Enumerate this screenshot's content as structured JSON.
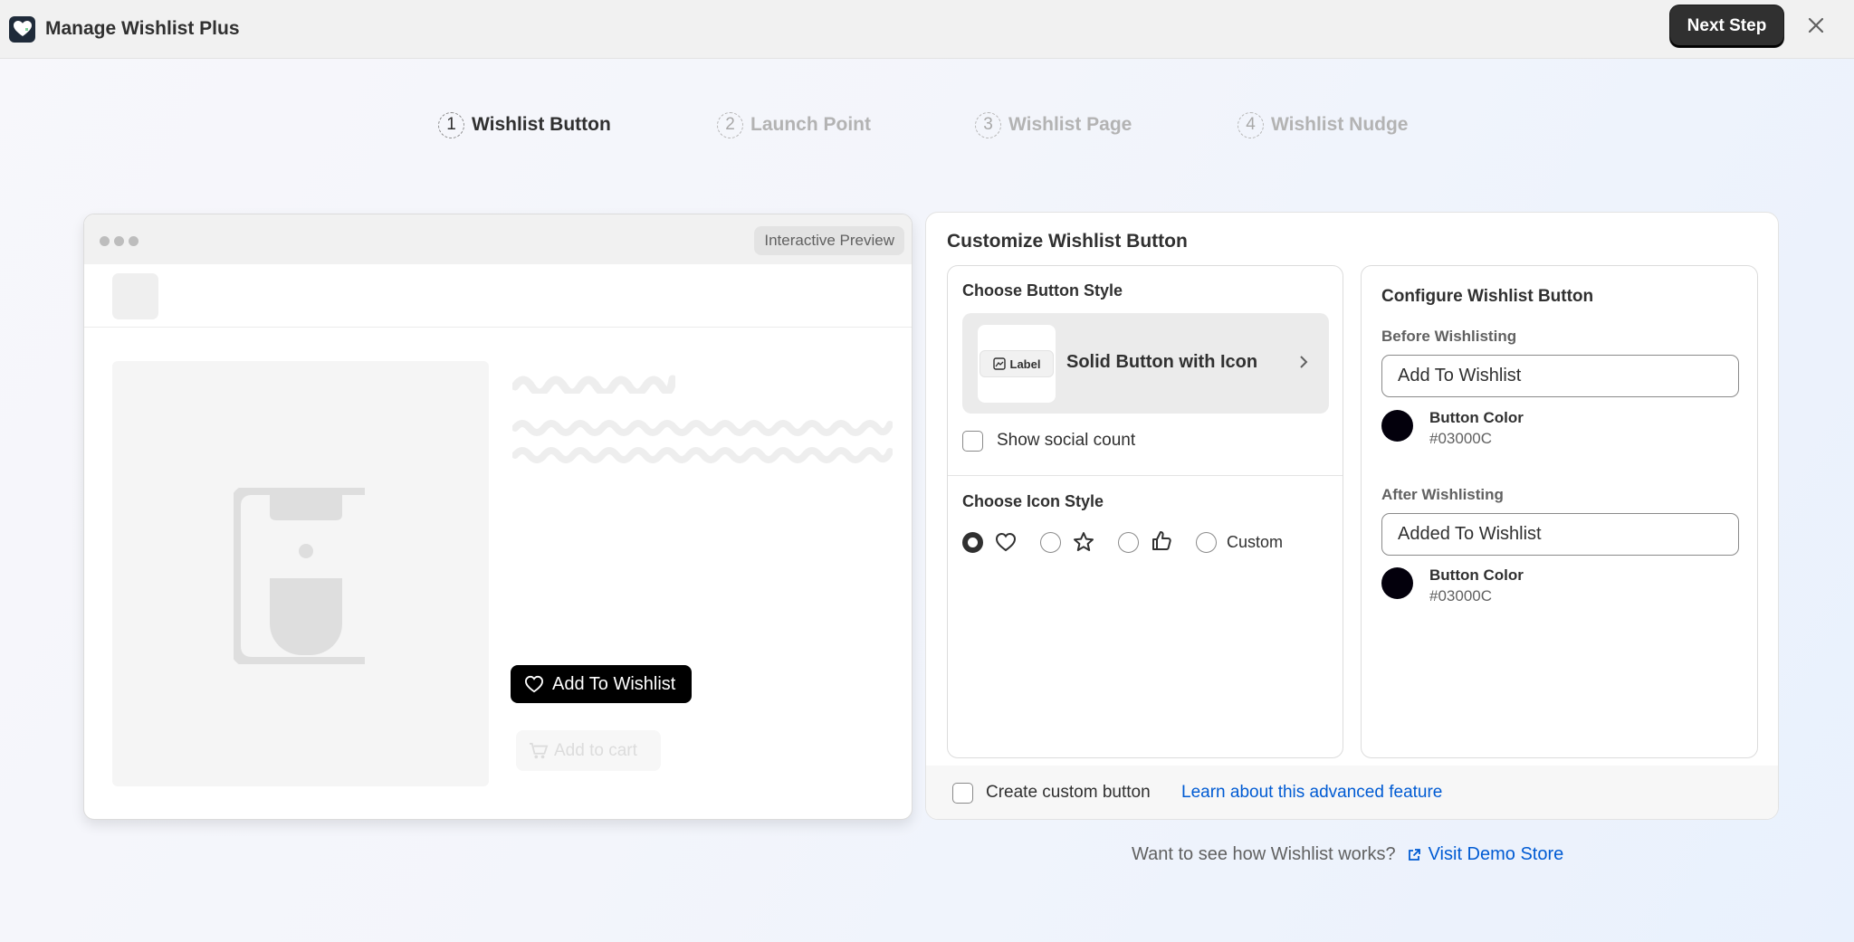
{
  "app": {
    "title": "Manage Wishlist Plus",
    "logo_icon": "heart-logo-icon",
    "brand_color": "#1f2b3a"
  },
  "topbar": {
    "next_step_label": "Next Step",
    "close_icon": "close-icon"
  },
  "steps": [
    {
      "number": "1",
      "label": "Wishlist Button",
      "active": true
    },
    {
      "number": "2",
      "label": "Launch Point",
      "active": false
    },
    {
      "number": "3",
      "label": "Wishlist Page",
      "active": false
    },
    {
      "number": "4",
      "label": "Wishlist Nudge",
      "active": false
    }
  ],
  "preview": {
    "tag": "Interactive Preview",
    "wishlist_button_label": "Add To Wishlist",
    "add_to_cart_label": "Add to cart"
  },
  "customize": {
    "title": "Customize Wishlist Button",
    "button_style": {
      "heading": "Choose Button Style",
      "thumb_label": "Label",
      "selected": "Solid Button with Icon"
    },
    "social_count_label": "Show social count",
    "icon_style": {
      "heading": "Choose Icon Style",
      "options": [
        "heart-icon",
        "star-icon",
        "thumbs-up-icon"
      ],
      "custom_label": "Custom",
      "selected_index": 0
    },
    "configure": {
      "heading": "Configure Wishlist Button",
      "before": {
        "heading": "Before Wishlisting",
        "value": "Add To Wishlist",
        "color_title": "Button Color",
        "color_hex": "#03000C"
      },
      "after": {
        "heading": "After Wishlisting",
        "value": "Added To Wishlist",
        "color_title": "Button Color",
        "color_hex": "#03000C"
      }
    },
    "footer": {
      "custom_button_label": "Create custom button",
      "learn_link": "Learn about this advanced feature"
    }
  },
  "bottom": {
    "question": "Want to see how Wishlist works?",
    "demo_link": "Visit Demo Store"
  },
  "colors": {
    "accent": "#303030",
    "link": "#005bd3",
    "button_color": "#03000C"
  }
}
